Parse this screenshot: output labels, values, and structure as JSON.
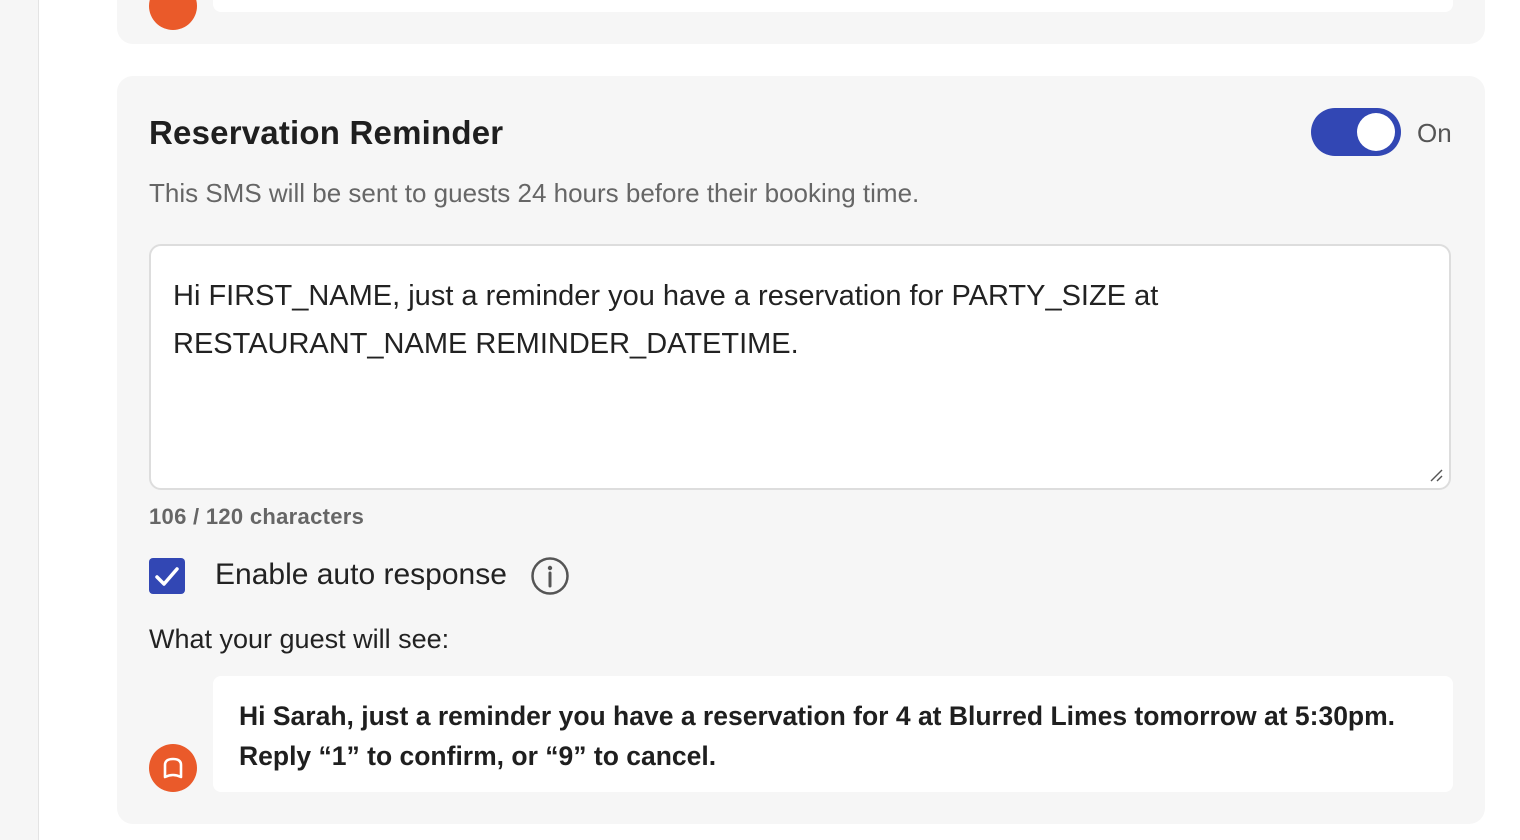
{
  "reminder": {
    "title": "Reservation Reminder",
    "toggle_state": "On",
    "description": "This SMS will be sent to guests 24 hours before their booking time.",
    "message_template": "Hi FIRST_NAME, just a reminder you have a reservation for PARTY_SIZE at RESTAURANT_NAME REMINDER_DATETIME.",
    "char_count": "106 / 120 characters",
    "auto_response_label": "Enable auto response",
    "auto_response_checked": true,
    "preview_label": "What your guest will see:",
    "preview_message": "Hi Sarah, just a reminder you have a reservation for 4 at Blurred Limes tomorrow at 5:30pm. Reply “1” to confirm, or “9” to cancel."
  },
  "colors": {
    "accent": "#3247b4",
    "avatar": "#ea5a2a",
    "card_bg": "#f6f6f6"
  },
  "icons": {
    "info": "info-circle-icon",
    "check": "checkmark-icon",
    "avatar": "restaurant-logo-icon"
  }
}
